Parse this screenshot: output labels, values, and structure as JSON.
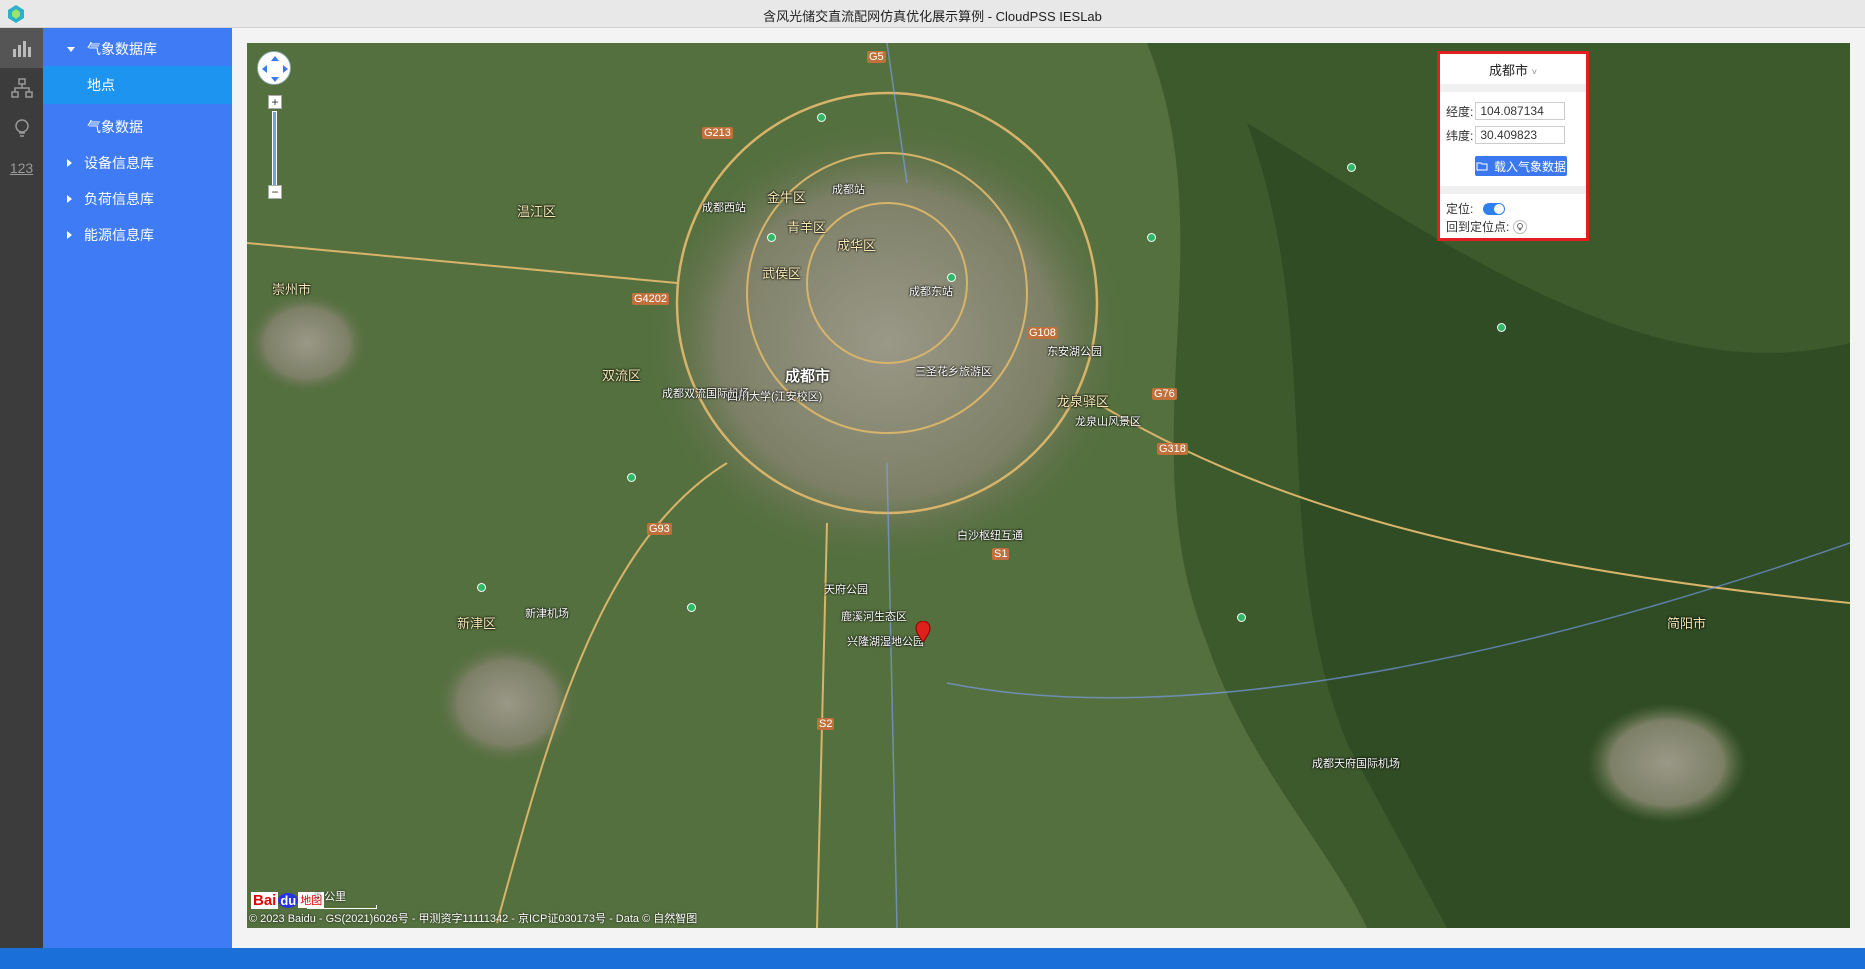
{
  "window": {
    "title": "含风光储交直流配网仿真优化展示算例 - CloudPSS IESLab"
  },
  "rail": {
    "items": [
      {
        "name": "chart-icon"
      },
      {
        "name": "network-icon"
      },
      {
        "name": "bulb-icon"
      },
      {
        "label": "123"
      }
    ]
  },
  "sidebar": {
    "weather_db": "气象数据库",
    "location": "地点",
    "weather_data": "气象数据",
    "device_db": "设备信息库",
    "load_db": "负荷信息库",
    "energy_db": "能源信息库"
  },
  "map": {
    "city_center": "成都市",
    "labels": {
      "jinniu": "金牛区",
      "qingyang": "青羊区",
      "chenghua": "成华区",
      "wuhou": "武侯区",
      "shuangliu": "双流区",
      "longquanyi": "龙泉驿区",
      "xindu": "新津区",
      "wenjiang": "温江区",
      "chongzhou": "崇州市",
      "jianyang": "简阳市",
      "chengdu_station": "成都站",
      "chengdu_east": "成都东站",
      "chengdu_west": "成都西站",
      "xinjin_airport": "新津机场",
      "shuangliu_airport": "成都双流国际机场",
      "tianfu_airport": "成都天府国际机场",
      "tianfu_park": "天府公园",
      "xinglong_park": "兴隆湖湿地公园",
      "luxi_park": "鹿溪河生态区",
      "longquan_park": "龙泉山风景区",
      "ring_east": "东安湖公园",
      "baisha": "白沙枢纽互通",
      "sanshenghua": "三圣花乡旅游区",
      "sichuan_univ": "四川大学(江安校区)"
    },
    "roads": {
      "g5": "G5",
      "g213": "G213",
      "g108": "G108",
      "g318": "G318",
      "g76": "G76",
      "g93": "G93",
      "s2": "S2",
      "s1": "S1",
      "g4202": "G4202"
    },
    "baidu_bai": "Bai",
    "baidu_du": "du",
    "baidu_map": "地图",
    "scale": "5 公里",
    "copyright": "© 2023 Baidu - GS(2021)6026号 - 甲测资字11111342 - 京ICP证030173号 - Data © 自然智图"
  },
  "location_panel": {
    "city": "成都市",
    "lng_label": "经度:",
    "lng_value": "104.087134",
    "lat_label": "纬度:",
    "lat_value": "30.409823",
    "load_button": "载入气象数据",
    "locate_label": "定位:",
    "locate_on": true,
    "return_label": "回到定位点:"
  }
}
